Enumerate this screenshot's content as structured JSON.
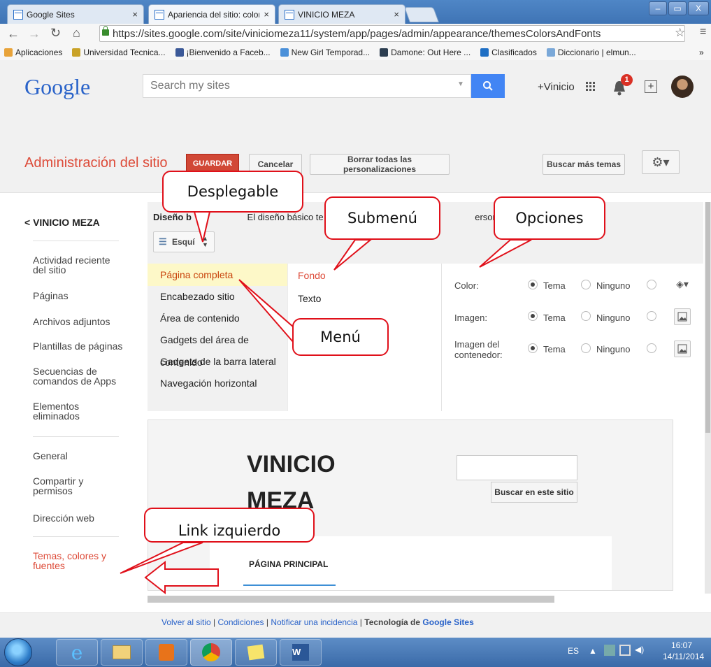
{
  "browser": {
    "tabs": [
      {
        "title": "Google Sites",
        "close": "×"
      },
      {
        "title": "Apariencia del sitio: colore",
        "close": "×"
      },
      {
        "title": "VINICIO MEZA",
        "close": "×"
      }
    ],
    "window_buttons": {
      "minimize": "–",
      "maximize": "▭",
      "close": "X"
    },
    "url": "https://sites.google.com/site/viniciomeza11/system/app/pages/admin/appearance/themesColorsAndFonts",
    "bookmarks": [
      {
        "label": "Aplicaciones",
        "color": "#e8a33a"
      },
      {
        "label": "Universidad Tecnica...",
        "color": "#c9a227"
      },
      {
        "label": "¡Bienvenido a Faceb...",
        "color": "#3b5998"
      },
      {
        "label": "New Girl Temporad...",
        "color": "#4a90d9"
      },
      {
        "label": "Damone: Out Here ...",
        "color": "#2c3e50"
      },
      {
        "label": "Clasificados",
        "color": "#1f6fc4"
      },
      {
        "label": "Diccionario | elmun...",
        "color": "#7aa8d8"
      }
    ],
    "bookmarks_more": "»"
  },
  "google": {
    "logo": "Google",
    "search_placeholder": "Search my sites",
    "user": "+Vinicio",
    "notification_count": "1",
    "add_icon": "+"
  },
  "admin": {
    "title": "Administración del sitio",
    "save": "GUARDAR",
    "cancel": "Cancelar",
    "reset": "Borrar todas las personalizaciones",
    "more_themes": "Buscar más temas",
    "settings": "⚙▾"
  },
  "sidebar": {
    "back": "< VINICIO MEZA",
    "items": [
      "Actividad reciente del sitio",
      "Páginas",
      "Archivos adjuntos",
      "Plantillas de páginas",
      "Secuencias de comandos de Apps",
      "Elementos eliminados",
      "General",
      "Compartir y permisos",
      "Dirección web",
      "Temas, colores y fuentes"
    ]
  },
  "panel": {
    "desc_bold": "Diseño b",
    "desc_a": "El diseño básico te permite",
    "desc_b": "ersonalizar",
    "layout_select": "Esquí",
    "menu": [
      "Página completa",
      "Encabezado sitio",
      "Área de contenido",
      "Gadgets del área de contenido",
      "Gadgets de la barra lateral",
      "Navegación horizontal"
    ],
    "submenu": [
      "Fondo",
      "Texto"
    ],
    "options": {
      "color_label": "Color:",
      "image_label": "Imagen:",
      "container_label": "Imagen del contenedor:",
      "theme": "Tema",
      "none": "Ninguno"
    }
  },
  "preview": {
    "site_title": "VINICIO MEZA",
    "search_button": "Buscar en este sitio",
    "nav_item": "PÁGINA PRINCIPAL"
  },
  "footer": {
    "back": "Volver al sitio",
    "terms": "Condiciones",
    "report": "Notificar una incidencia",
    "tech_prefix": "Tecnología de",
    "tech_link": "Google Sites",
    "sep": "|"
  },
  "taskbar": {
    "lang": "ES",
    "time": "16:07",
    "date": "14/11/2014"
  },
  "annotations": {
    "desplegable": "Desplegable",
    "submenu": "Submenú",
    "opciones": "Opciones",
    "menu": "Menú",
    "link": "Link izquierdo"
  },
  "colors": {
    "accent_red": "#dd4b39",
    "google_blue": "#4285f4",
    "callout_red": "#e0101a"
  }
}
